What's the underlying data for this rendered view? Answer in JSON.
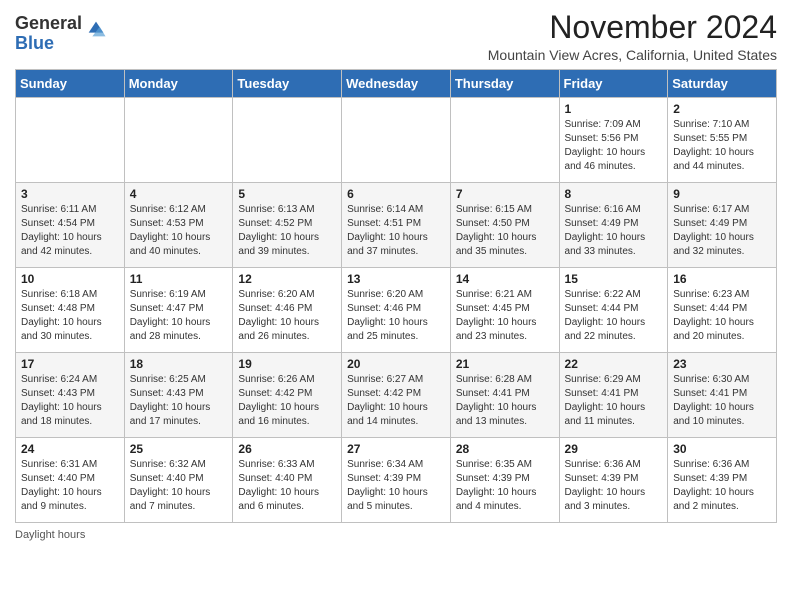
{
  "header": {
    "logo_line1": "General",
    "logo_line2": "Blue",
    "month": "November 2024",
    "location": "Mountain View Acres, California, United States"
  },
  "days_of_week": [
    "Sunday",
    "Monday",
    "Tuesday",
    "Wednesday",
    "Thursday",
    "Friday",
    "Saturday"
  ],
  "weeks": [
    [
      {
        "day": "",
        "info": ""
      },
      {
        "day": "",
        "info": ""
      },
      {
        "day": "",
        "info": ""
      },
      {
        "day": "",
        "info": ""
      },
      {
        "day": "",
        "info": ""
      },
      {
        "day": "1",
        "info": "Sunrise: 7:09 AM\nSunset: 5:56 PM\nDaylight: 10 hours and 46 minutes."
      },
      {
        "day": "2",
        "info": "Sunrise: 7:10 AM\nSunset: 5:55 PM\nDaylight: 10 hours and 44 minutes."
      }
    ],
    [
      {
        "day": "3",
        "info": "Sunrise: 6:11 AM\nSunset: 4:54 PM\nDaylight: 10 hours and 42 minutes."
      },
      {
        "day": "4",
        "info": "Sunrise: 6:12 AM\nSunset: 4:53 PM\nDaylight: 10 hours and 40 minutes."
      },
      {
        "day": "5",
        "info": "Sunrise: 6:13 AM\nSunset: 4:52 PM\nDaylight: 10 hours and 39 minutes."
      },
      {
        "day": "6",
        "info": "Sunrise: 6:14 AM\nSunset: 4:51 PM\nDaylight: 10 hours and 37 minutes."
      },
      {
        "day": "7",
        "info": "Sunrise: 6:15 AM\nSunset: 4:50 PM\nDaylight: 10 hours and 35 minutes."
      },
      {
        "day": "8",
        "info": "Sunrise: 6:16 AM\nSunset: 4:49 PM\nDaylight: 10 hours and 33 minutes."
      },
      {
        "day": "9",
        "info": "Sunrise: 6:17 AM\nSunset: 4:49 PM\nDaylight: 10 hours and 32 minutes."
      }
    ],
    [
      {
        "day": "10",
        "info": "Sunrise: 6:18 AM\nSunset: 4:48 PM\nDaylight: 10 hours and 30 minutes."
      },
      {
        "day": "11",
        "info": "Sunrise: 6:19 AM\nSunset: 4:47 PM\nDaylight: 10 hours and 28 minutes."
      },
      {
        "day": "12",
        "info": "Sunrise: 6:20 AM\nSunset: 4:46 PM\nDaylight: 10 hours and 26 minutes."
      },
      {
        "day": "13",
        "info": "Sunrise: 6:20 AM\nSunset: 4:46 PM\nDaylight: 10 hours and 25 minutes."
      },
      {
        "day": "14",
        "info": "Sunrise: 6:21 AM\nSunset: 4:45 PM\nDaylight: 10 hours and 23 minutes."
      },
      {
        "day": "15",
        "info": "Sunrise: 6:22 AM\nSunset: 4:44 PM\nDaylight: 10 hours and 22 minutes."
      },
      {
        "day": "16",
        "info": "Sunrise: 6:23 AM\nSunset: 4:44 PM\nDaylight: 10 hours and 20 minutes."
      }
    ],
    [
      {
        "day": "17",
        "info": "Sunrise: 6:24 AM\nSunset: 4:43 PM\nDaylight: 10 hours and 18 minutes."
      },
      {
        "day": "18",
        "info": "Sunrise: 6:25 AM\nSunset: 4:43 PM\nDaylight: 10 hours and 17 minutes."
      },
      {
        "day": "19",
        "info": "Sunrise: 6:26 AM\nSunset: 4:42 PM\nDaylight: 10 hours and 16 minutes."
      },
      {
        "day": "20",
        "info": "Sunrise: 6:27 AM\nSunset: 4:42 PM\nDaylight: 10 hours and 14 minutes."
      },
      {
        "day": "21",
        "info": "Sunrise: 6:28 AM\nSunset: 4:41 PM\nDaylight: 10 hours and 13 minutes."
      },
      {
        "day": "22",
        "info": "Sunrise: 6:29 AM\nSunset: 4:41 PM\nDaylight: 10 hours and 11 minutes."
      },
      {
        "day": "23",
        "info": "Sunrise: 6:30 AM\nSunset: 4:41 PM\nDaylight: 10 hours and 10 minutes."
      }
    ],
    [
      {
        "day": "24",
        "info": "Sunrise: 6:31 AM\nSunset: 4:40 PM\nDaylight: 10 hours and 9 minutes."
      },
      {
        "day": "25",
        "info": "Sunrise: 6:32 AM\nSunset: 4:40 PM\nDaylight: 10 hours and 7 minutes."
      },
      {
        "day": "26",
        "info": "Sunrise: 6:33 AM\nSunset: 4:40 PM\nDaylight: 10 hours and 6 minutes."
      },
      {
        "day": "27",
        "info": "Sunrise: 6:34 AM\nSunset: 4:39 PM\nDaylight: 10 hours and 5 minutes."
      },
      {
        "day": "28",
        "info": "Sunrise: 6:35 AM\nSunset: 4:39 PM\nDaylight: 10 hours and 4 minutes."
      },
      {
        "day": "29",
        "info": "Sunrise: 6:36 AM\nSunset: 4:39 PM\nDaylight: 10 hours and 3 minutes."
      },
      {
        "day": "30",
        "info": "Sunrise: 6:36 AM\nSunset: 4:39 PM\nDaylight: 10 hours and 2 minutes."
      }
    ]
  ],
  "footer": {
    "note": "Daylight hours"
  }
}
